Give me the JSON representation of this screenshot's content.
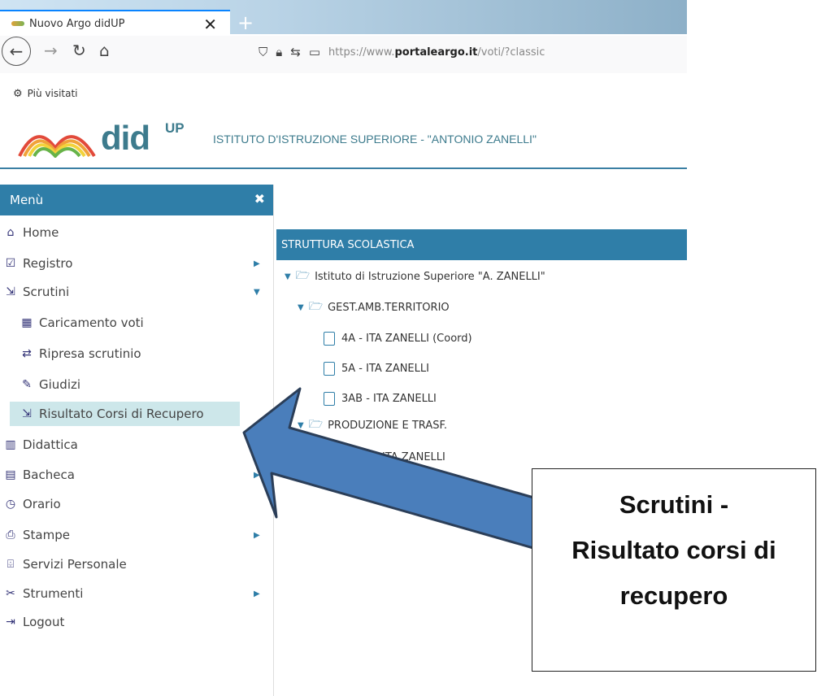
{
  "browser": {
    "tab_title": "Nuovo Argo didUP",
    "tab_close": "✕",
    "new_tab": "+",
    "url_prefix": "https://www.",
    "url_host": "portaleargo.it",
    "url_path": "/voti/?classic",
    "bookmarks_label": "Più visitati"
  },
  "app": {
    "logo_text": "did",
    "logo_sup": "UP",
    "school_name": "ISTITUTO D'ISTRUZIONE SUPERIORE - \"ANTONIO ZANELLI\""
  },
  "sidebar": {
    "title": "Menù",
    "close": "✖",
    "items": [
      {
        "label": "Home",
        "icon": "home-icon"
      },
      {
        "label": "Registro",
        "icon": "calendar-icon"
      },
      {
        "label": "Scrutini",
        "icon": "export-icon"
      },
      {
        "label": "Caricamento voti",
        "icon": "grid-icon"
      },
      {
        "label": "Ripresa scrutinio",
        "icon": "recycle-icon"
      },
      {
        "label": "Giudizi",
        "icon": "edit-icon"
      },
      {
        "label": "Risultato Corsi di Recupero",
        "icon": "export-icon"
      },
      {
        "label": "Didattica",
        "icon": "book-icon"
      },
      {
        "label": "Bacheca",
        "icon": "board-icon"
      },
      {
        "label": "Orario",
        "icon": "clock-icon"
      },
      {
        "label": "Stampe",
        "icon": "printer-icon"
      },
      {
        "label": "Servizi Personale",
        "icon": "briefcase-icon"
      },
      {
        "label": "Strumenti",
        "icon": "tools-icon"
      },
      {
        "label": "Logout",
        "icon": "logout-icon"
      }
    ]
  },
  "main": {
    "section_title": "STRUTTURA SCOLASTICA",
    "tree": {
      "root": "Istituto di Istruzione Superiore \"A. ZANELLI\"",
      "group1": "GEST.AMB.TERRITORIO",
      "classes1": [
        "4A - ITA ZANELLI (Coord)",
        "5A - ITA ZANELLI",
        "3AB - ITA ZANELLI"
      ],
      "group2": "PRODUZIONE E TRASF.",
      "classes2_partial": "ITA ZANELLI"
    }
  },
  "annotation": {
    "line1": "Scrutini -",
    "line2": "Risultato corsi di",
    "line3": "recupero",
    "arrow_color": "#4a7ebb"
  }
}
